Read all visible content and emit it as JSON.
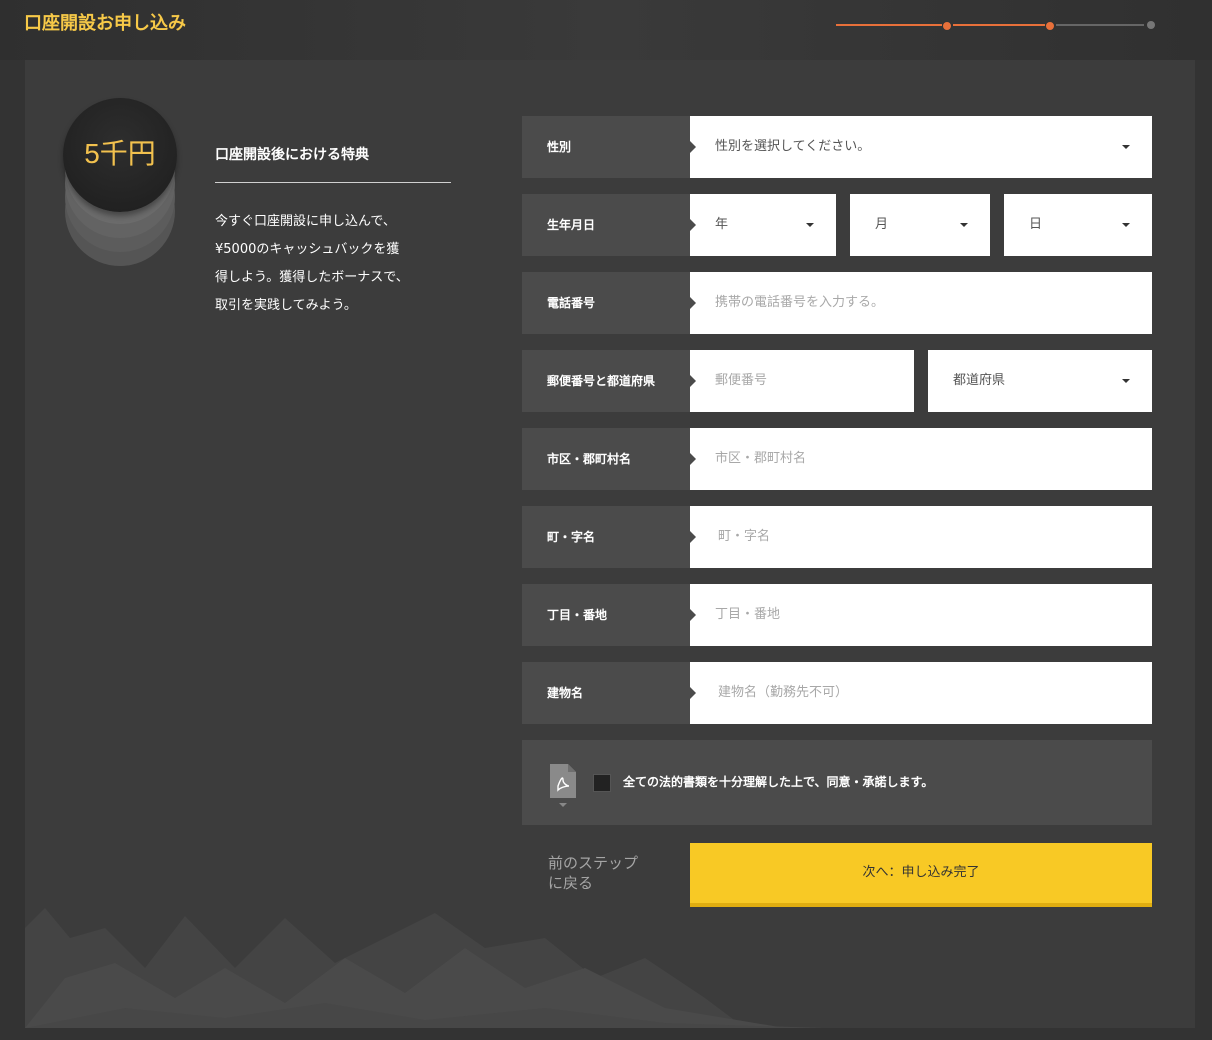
{
  "header": {
    "title": "口座開設お申し込み",
    "progress": {
      "total_steps": 3,
      "current_step": 3
    }
  },
  "benefit": {
    "coin_amount": "5千円",
    "title": "口座開設後における特典",
    "description": "今すぐ口座開設に申し込んで、\n¥5000のキャッシュバックを獲\n得しよう。獲得したボーナスで、\n取引を実践してみよう。"
  },
  "form": {
    "gender": {
      "label": "性別",
      "value": "性別を選択してください。"
    },
    "birthdate": {
      "label": "生年月日",
      "year": "年",
      "month": "月",
      "day": "日"
    },
    "phone": {
      "label": "電話番号",
      "placeholder": "携帯の電話番号を入力する。"
    },
    "postal": {
      "label": "郵便番号と都道府県",
      "postal_placeholder": "郵便番号",
      "prefecture": "都道府県"
    },
    "city": {
      "label": "市区・郡町村名",
      "placeholder": "市区・郡町村名"
    },
    "town": {
      "label": "町・字名",
      "placeholder": "町・字名"
    },
    "block": {
      "label": "丁目・番地",
      "placeholder": "丁目・番地"
    },
    "building": {
      "label": "建物名",
      "placeholder": "建物名（勤務先不可）"
    },
    "agreement": {
      "text": "全ての法的書類を十分理解した上で、同意・承諾します。",
      "checked": false
    },
    "back_label": "前のステップ\nに戻る",
    "next_label": "次へ：申し込み完了"
  },
  "colors": {
    "accent": "#f8c925",
    "title": "#f7c948",
    "progress_active": "#e8703a",
    "progress_inactive": "#666666"
  }
}
